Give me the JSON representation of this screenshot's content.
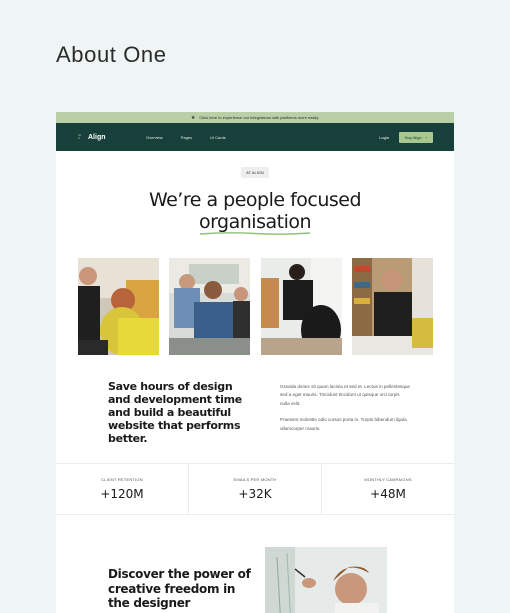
{
  "card": {
    "title": "About One"
  },
  "announcement": {
    "text": "Click here to experience our integrations with platforms more easily.",
    "icon": "star-icon"
  },
  "nav": {
    "logo_mark": "align-logo-mark",
    "logo_text": "Align",
    "links": [
      "Overview",
      "Pages",
      "UI Cards"
    ],
    "login": "Login",
    "buy_label": "Buy Align",
    "buy_icon": "chevron-right-icon"
  },
  "hero": {
    "pill": "AT ALIGN",
    "heading_line1": "We’re a people focused",
    "heading_line2": "organisation"
  },
  "intro": {
    "headline": "Save hours of design and development time and build a beautiful website that performs better.",
    "paragraph1": "Gravida donec sit quam lacinia et sed et. Lectus in pellentesque sed a eget mauris. Tincidunt tincidunt ut quisque orci turpis nulla velit.",
    "paragraph2": "Praesent molestie odio cursus porta in. Turpis bibendum ligula ullamcorper mauris."
  },
  "stats": [
    {
      "label": "CLIENT RETENTION",
      "value": "+120M"
    },
    {
      "label": "EMAILS PER MONTH",
      "value": "+32K"
    },
    {
      "label": "MONTHLY CAMPAIGNS",
      "value": "+48M"
    }
  ],
  "discover": {
    "headline": "Discover the power of creative freedom in the designer"
  },
  "colors": {
    "background": "#eef5f4",
    "announcement": "#b9cfa6",
    "nav": "#17403a",
    "accent_button": "#a9c88f",
    "underline": "#8fbf7a"
  }
}
